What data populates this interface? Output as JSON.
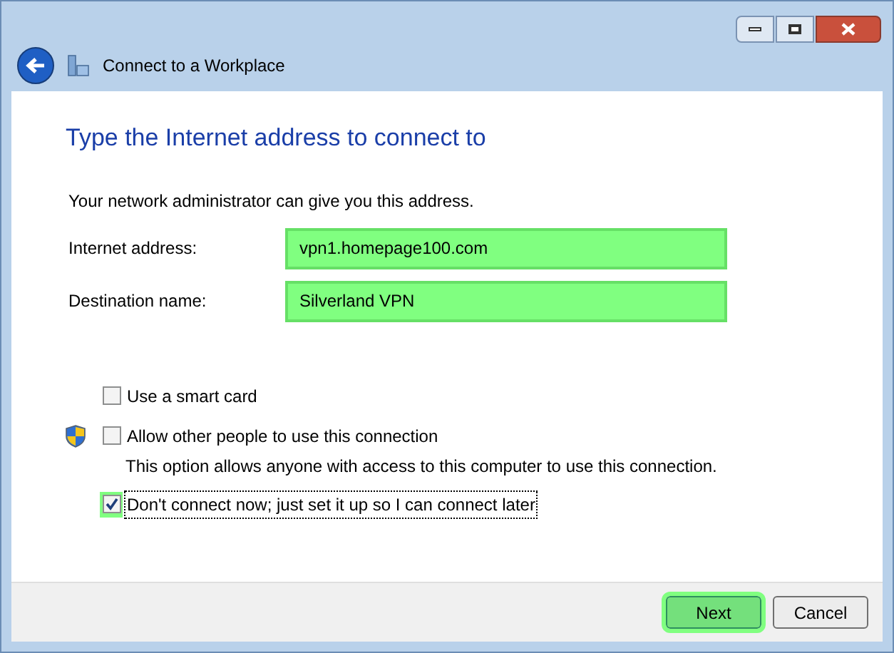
{
  "window": {
    "title": "Connect to a Workplace"
  },
  "heading": "Type the Internet address to connect to",
  "intro": "Your network administrator can give you this address.",
  "fields": [
    {
      "label": "Internet address:",
      "value": "vpn1.homepage100.com",
      "highlighted": true
    },
    {
      "label": "Destination name:",
      "value": "Silverland VPN",
      "highlighted": true
    }
  ],
  "options": [
    {
      "label": "Use a smart card",
      "checked": false,
      "shield": false,
      "highlighted": false,
      "focused": false
    },
    {
      "label": "Allow other people to use this connection",
      "checked": false,
      "shield": true,
      "highlighted": false,
      "focused": false,
      "description": "This option allows anyone with access to this computer to use this connection."
    },
    {
      "label": "Don't connect now; just set it up so I can connect later",
      "checked": true,
      "shield": false,
      "highlighted": true,
      "focused": true
    }
  ],
  "buttons": [
    {
      "label": "Next",
      "highlighted": true
    },
    {
      "label": "Cancel",
      "highlighted": false
    }
  ]
}
